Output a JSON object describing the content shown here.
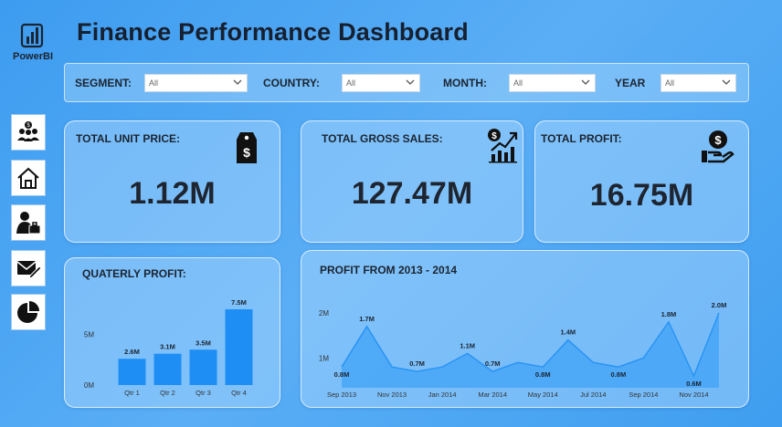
{
  "app": {
    "logo_text": "PowerBI",
    "title": "Finance Performance Dashboard"
  },
  "filters": [
    {
      "label": "SEGMENT",
      "value": "All"
    },
    {
      "label": "COUNTRY",
      "value": "All"
    },
    {
      "label": "MONTH",
      "value": "All"
    },
    {
      "label": "YEAR",
      "value": "All"
    }
  ],
  "nav": [
    {
      "icon": "people-money-icon"
    },
    {
      "icon": "home-icon"
    },
    {
      "icon": "businessman-icon"
    },
    {
      "icon": "mail-edit-icon"
    },
    {
      "icon": "pie-chart-icon"
    }
  ],
  "kpis": {
    "unit_price": {
      "title": "TOTAL UNIT PRICE:",
      "value": "1.12M",
      "icon": "price-tag-icon"
    },
    "gross_sales": {
      "title": "TOTAL GROSS SALES:",
      "value": "127.47M",
      "icon": "growth-chart-icon"
    },
    "profit": {
      "title": "TOTAL PROFIT:",
      "value": "16.75M",
      "icon": "hand-money-icon"
    }
  },
  "colors": {
    "accent": "#1e8ef5",
    "area": "#47a6f7",
    "line": "#2a94f3"
  },
  "chart_data": [
    {
      "type": "bar",
      "title": "QUATERLY PROFIT:",
      "categories": [
        "Qtr 1",
        "Qtr 2",
        "Qtr 3",
        "Qtr 4"
      ],
      "values": [
        2.6,
        3.1,
        3.5,
        7.5
      ],
      "value_labels": [
        "2.6M",
        "3.1M",
        "3.5M",
        "7.5M"
      ],
      "yticks": [
        "0M",
        "5M"
      ],
      "ylim": [
        0,
        7.5
      ],
      "unit": "M"
    },
    {
      "type": "area",
      "title": "PROFIT FROM 2013 - 2014",
      "x": [
        "Sep 2013",
        "Oct 2013",
        "Nov 2013",
        "Dec 2013",
        "Jan 2014",
        "Feb 2014",
        "Mar 2014",
        "Apr 2014",
        "May 2014",
        "Jun 2014",
        "Jul 2014",
        "Aug 2014",
        "Sep 2014",
        "Oct 2014",
        "Nov 2014",
        "Dec 2014"
      ],
      "values": [
        0.8,
        1.7,
        0.8,
        0.7,
        0.8,
        1.1,
        0.7,
        0.9,
        0.8,
        1.4,
        0.9,
        0.8,
        1.0,
        1.8,
        0.6,
        2.0
      ],
      "data_labels": [
        {
          "index": 0,
          "text": "0.8M"
        },
        {
          "index": 1,
          "text": "1.7M"
        },
        {
          "index": 3,
          "text": "0.7M"
        },
        {
          "index": 5,
          "text": "1.1M"
        },
        {
          "index": 6,
          "text": "0.7M"
        },
        {
          "index": 8,
          "text": "0.8M"
        },
        {
          "index": 9,
          "text": "1.4M"
        },
        {
          "index": 11,
          "text": "0.8M"
        },
        {
          "index": 13,
          "text": "1.8M"
        },
        {
          "index": 14,
          "text": "0.6M"
        },
        {
          "index": 15,
          "text": "2.0M"
        }
      ],
      "xticks": [
        "Sep 2013",
        "Nov 2013",
        "Jan 2014",
        "Mar 2014",
        "May 2014",
        "Jul 2014",
        "Sep 2014",
        "Nov 2014"
      ],
      "yticks": [
        "1M",
        "2M"
      ],
      "ylim": [
        0.5,
        2.0
      ],
      "unit": "M"
    }
  ]
}
